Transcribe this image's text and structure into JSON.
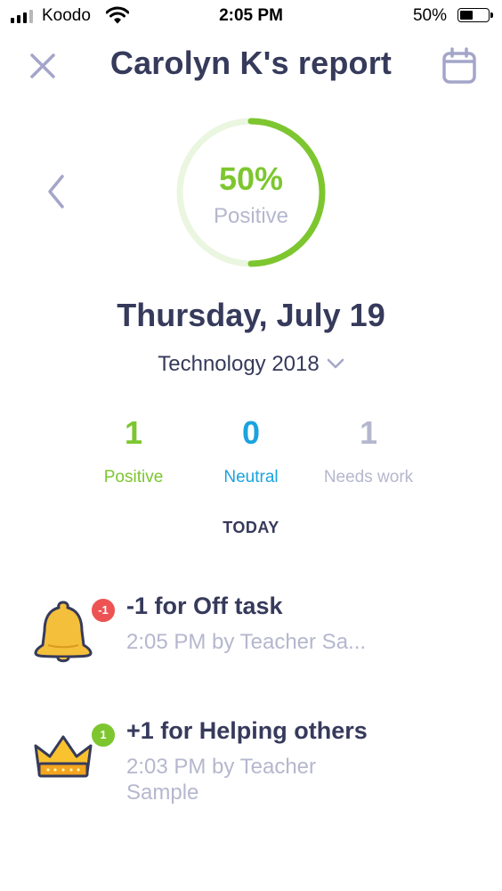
{
  "status_bar": {
    "carrier": "Koodo",
    "time": "2:05 PM",
    "battery": "50%"
  },
  "header": {
    "title": "Carolyn K's report",
    "close_icon": "close-icon",
    "calendar_icon": "calendar-icon"
  },
  "summary": {
    "percent": "50%",
    "percent_label": "Positive",
    "fraction_positive": 0.5,
    "ring_color": "#7dc62f",
    "ring_track_color": "#eaf6df"
  },
  "date": "Thursday, July 19",
  "class_selector": "Technology 2018",
  "stats": {
    "positive": {
      "value": "1",
      "label": "Positive",
      "color": "#7dc62f"
    },
    "neutral": {
      "value": "0",
      "label": "Neutral",
      "color": "#1aa3de"
    },
    "needs_work": {
      "value": "1",
      "label": "Needs work",
      "color": "#b5b7ce"
    }
  },
  "section_label": "TODAY",
  "events": [
    {
      "icon": "bell-icon",
      "badge": "-1",
      "title": "-1 for Off task",
      "meta": "2:05 PM by Teacher Sa..."
    },
    {
      "icon": "crown-icon",
      "badge": "1",
      "title": "+1 for Helping others",
      "meta": "2:03 PM by Teacher Sample"
    }
  ]
}
